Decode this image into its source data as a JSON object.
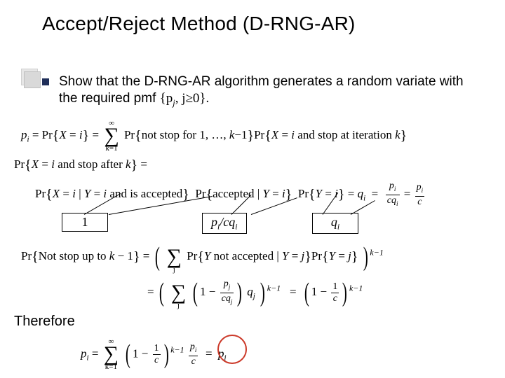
{
  "title": "Accept/Reject Method (D-RNG-AR)",
  "bullet": {
    "lead": "Show that the D-RNG-AR algorithm generates a random variate with the required pmf ",
    "pmf_set": "{p",
    "pmf_sub": "j",
    "pmf_mid": ", j",
    "pmf_tail": "0}."
  },
  "eq1": {
    "lhs_p": "p",
    "lhs_i": "i",
    "eq": " = Pr",
    "br1": "{X = i} = ",
    "sum_top": "∞",
    "sum_bot": "k=1",
    "pr_notstop": "Pr{not stop for 1, …, k−1}Pr{X = i and stop at iteration k}"
  },
  "eq2": {
    "lhs": "Pr{X = i and stop after k} =",
    "line2a": "Pr{X = i | Y = i and is accepted}",
    "line2b": "Pr{accepted | Y = i}",
    "line2c": "Pr{Y = i} = q",
    "line2c_sub": "i",
    "rhs_eq": " = ",
    "frac1_n": "p",
    "frac1_n_sub": "i",
    "frac1_d": "cq",
    "frac1_d_sub": "i",
    "frac2_n": "p",
    "frac2_n_sub": "i",
    "frac2_d": "c"
  },
  "boxes": {
    "one": "1",
    "ratio": "p",
    "ratio_i": "i",
    "ratio_mid": "/cq",
    "ratio_i2": "i",
    "q": "q",
    "q_i": "i"
  },
  "eq3": {
    "lhs": "Pr{Not stop up to k − 1} = ",
    "inside1": "Pr{Y not accepted | Y = j}Pr{Y = j}",
    "exp1": "k−1",
    "sum_j": "j",
    "row2_eq": " = ",
    "one_minus": "1 − ",
    "pj_n": "p",
    "pj_n_sub": "j",
    "pj_d": "cq",
    "pj_d_sub": "j",
    "qj": "q",
    "qj_sub": "j",
    "row2_rhs_eq": " = ",
    "one_minus2": "1 − ",
    "one": "1",
    "c": "c"
  },
  "therefore": "Therefore",
  "eq4": {
    "lhs_p": "p",
    "lhs_i": "i",
    "eq": " = ",
    "sum_top": "∞",
    "sum_bot": "k=1",
    "one_minus": "1 − ",
    "one": "1",
    "c": "c",
    "exp": "k−1",
    "pn": "p",
    "pn_sub": "i",
    "pd": "c",
    "rhs_eq": " = ",
    "rhs_p": "p",
    "rhs_i": "i"
  }
}
